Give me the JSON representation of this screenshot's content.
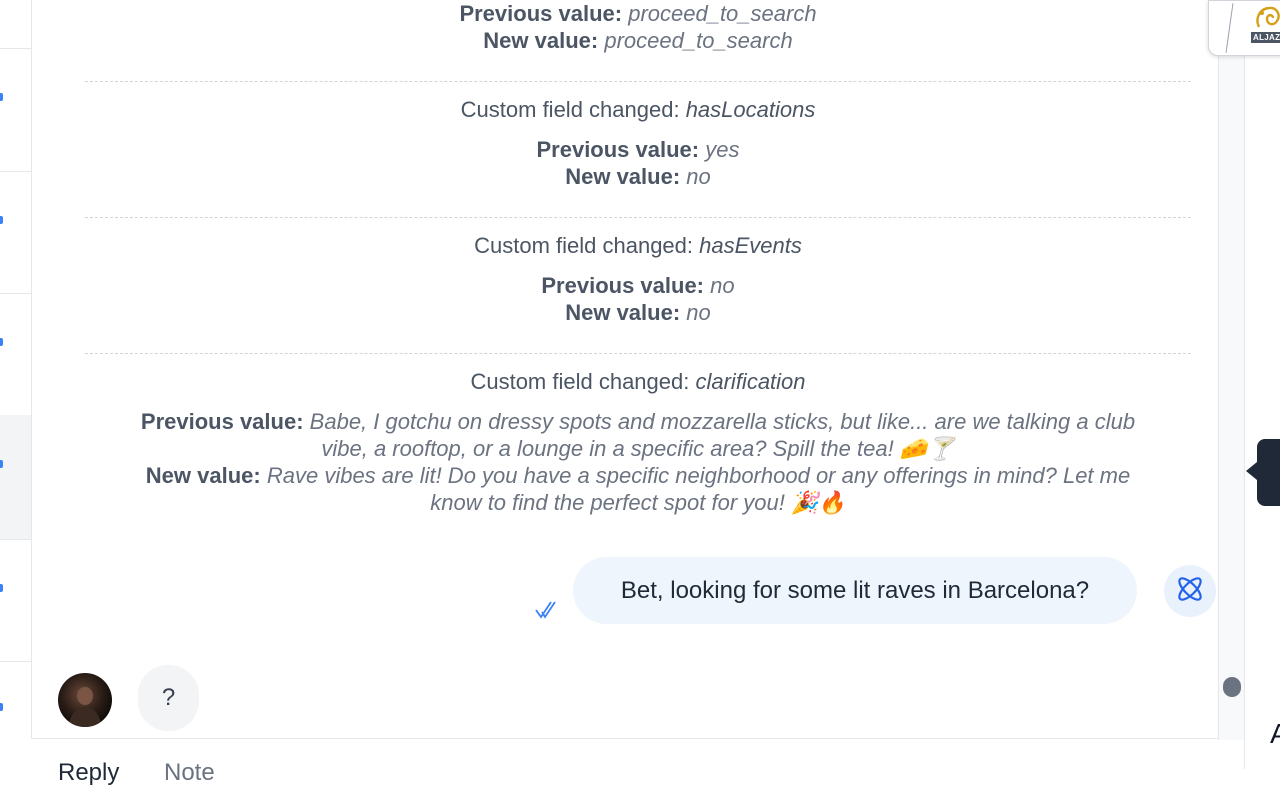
{
  "brand": {
    "name": "ALJAZEERA",
    "logo_icon": "aljazeera-logo"
  },
  "activities": [
    {
      "previous_label": "Previous value:",
      "previous_value": "proceed_to_search",
      "new_label": "New value:",
      "new_value": "proceed_to_search"
    },
    {
      "title_prefix": "Custom field changed:",
      "field": "hasLocations",
      "previous_label": "Previous value:",
      "previous_value": "yes",
      "new_label": "New value:",
      "new_value": "no"
    },
    {
      "title_prefix": "Custom field changed:",
      "field": "hasEvents",
      "previous_label": "Previous value:",
      "previous_value": "no",
      "new_label": "New value:",
      "new_value": "no"
    },
    {
      "title_prefix": "Custom field changed:",
      "field": "clarification",
      "previous_label": "Previous value:",
      "previous_value": "Babe, I gotchu on dressy spots and mozzarella sticks, but like... are we talking a club vibe, a rooftop, or a lounge in a specific area? Spill the tea! 🧀🍸",
      "new_label": "New value:",
      "new_value": "Rave vibes are lit! Do you have a specific neighborhood or any offerings in mind? Let me know to find the perfect spot for you! 🎉🔥"
    }
  ],
  "messages": {
    "outgoing_text": "Bet, looking for some lit raves in Barcelona?",
    "incoming_text": "?"
  },
  "reply_box": {
    "tab_reply": "Reply",
    "tab_note": "Note"
  },
  "right_edge": {
    "letter": "A"
  },
  "colors": {
    "bubble_bg": "#eef5fd",
    "accent": "#3b82f6",
    "collapse_tab": "#1f2937"
  }
}
